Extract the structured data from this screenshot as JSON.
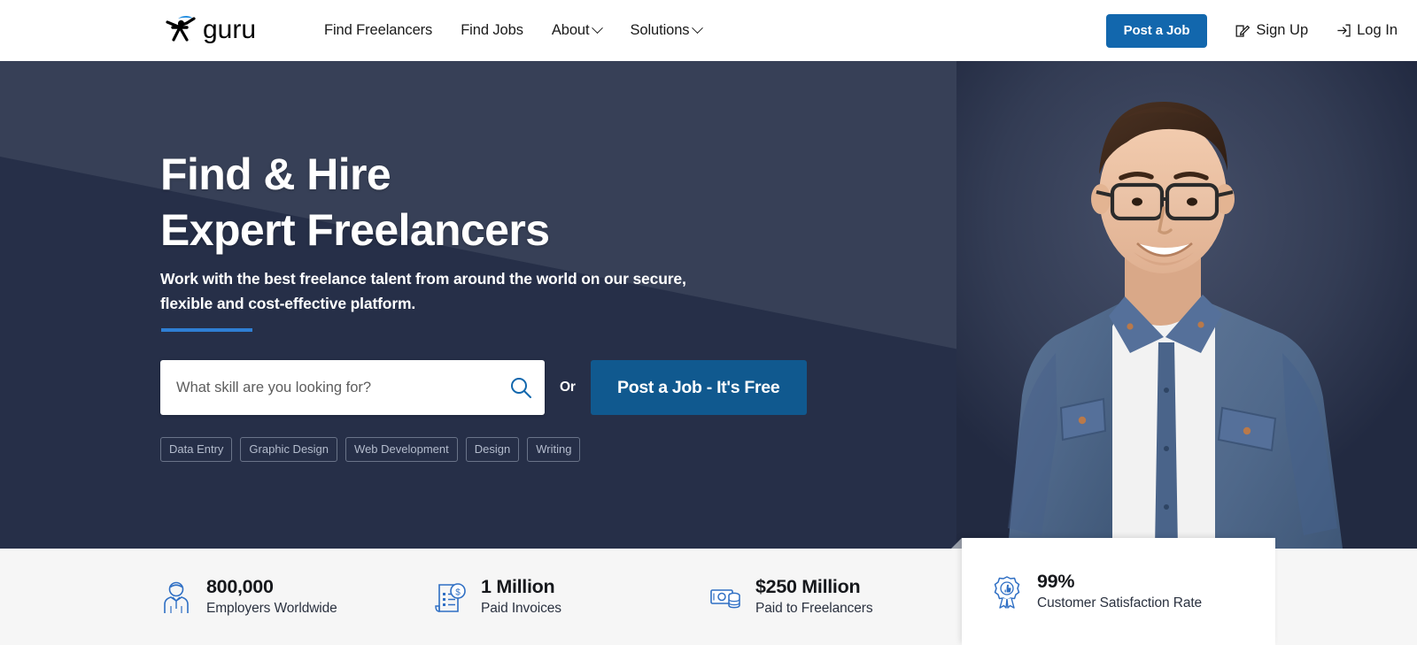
{
  "brand": {
    "name": "guru",
    "logo_icon": "guru-logo-icon",
    "accent_blue": "#2f7fd4",
    "button_blue": "#1267ad",
    "hero_dark": "#374057",
    "hero_darker": "#262f48"
  },
  "header": {
    "nav": [
      {
        "label": "Find Freelancers",
        "has_caret": false
      },
      {
        "label": "Find Jobs",
        "has_caret": false
      },
      {
        "label": "About",
        "has_caret": true
      },
      {
        "label": "Solutions",
        "has_caret": true
      }
    ],
    "post_job_label": "Post a Job",
    "sign_up_label": "Sign Up",
    "sign_up_icon": "edit-pencil-square-icon",
    "log_in_label": "Log In",
    "log_in_icon": "login-arrow-icon"
  },
  "hero": {
    "title_line1": "Find & Hire",
    "title_line2": "Expert Freelancers",
    "subtitle": "Work with the best freelance talent from around the world on our secure, flexible and cost-effective platform.",
    "search_placeholder": "What skill are you looking for?",
    "search_value": "",
    "search_icon": "search-icon",
    "or_label": "Or",
    "post_job_free_label": "Post a Job - It's Free",
    "chips": [
      "Data Entry",
      "Graphic Design",
      "Web Development",
      "Design",
      "Writing"
    ],
    "photo_alt": "smiling-man-with-glasses-photo"
  },
  "stats": [
    {
      "icon": "employer-person-icon",
      "number": "800,000",
      "label": "Employers Worldwide"
    },
    {
      "icon": "invoice-dollar-icon",
      "number": "1 Million",
      "label": "Paid Invoices"
    },
    {
      "icon": "money-cash-icon",
      "number": "$250 Million",
      "label": "Paid to Freelancers"
    },
    {
      "icon": "award-ribbon-thumbsup-icon",
      "number": "99%",
      "label": "Customer Satisfaction Rate"
    }
  ]
}
